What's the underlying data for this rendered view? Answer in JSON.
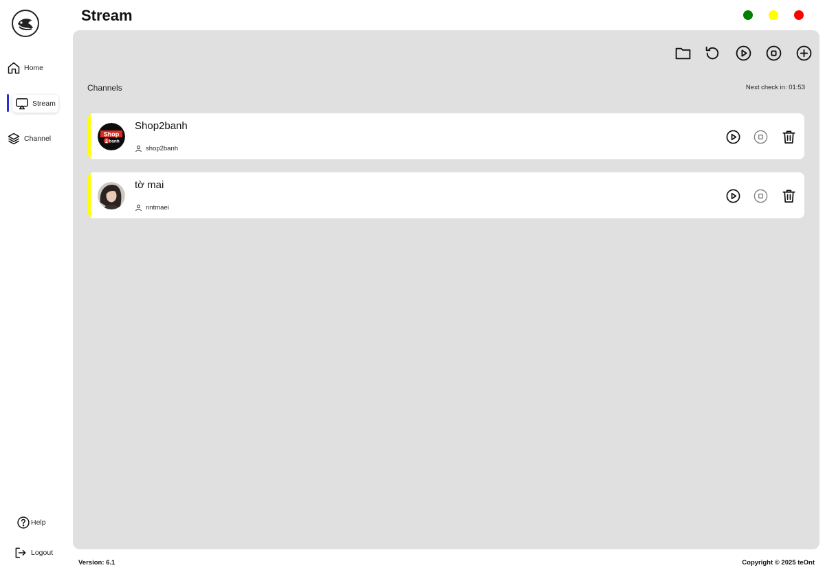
{
  "app": {
    "page_title": "Stream"
  },
  "window_controls": {
    "green": "#008000",
    "yellow": "#ffff00",
    "red": "#ff0000"
  },
  "sidebar": {
    "logo_icon": "fish-logo-icon",
    "items": [
      {
        "label": "Home",
        "icon": "home-icon"
      },
      {
        "label": "Stream",
        "icon": "cast-icon",
        "active": true
      },
      {
        "label": "Channel",
        "icon": "layers-icon"
      }
    ],
    "help": {
      "label": "Help",
      "icon": "question-circle-icon"
    },
    "logout": {
      "label": "Logout",
      "icon": "logout-icon"
    },
    "active_indicator_color": "#2b2bd6"
  },
  "toolbar": {
    "icons": [
      "folder-icon",
      "refresh-icon",
      "play-circle-icon",
      "stop-circle-icon",
      "plus-circle-icon"
    ]
  },
  "main": {
    "section_label": "Channels",
    "next_check": "Next check in: 01:53",
    "panel_color": "#e0e0e0",
    "card_accent_color": "#ffff00",
    "channels": [
      {
        "name": "Shop2banh",
        "username": "shop2banh",
        "avatar_text_1": "Shop",
        "avatar_text_2": "2",
        "avatar_text_3": "banh"
      },
      {
        "name": "tờ mai",
        "username": "nntmaei"
      }
    ]
  },
  "footer": {
    "version": "Version: 6.1",
    "copyright": "Copyright © 2025 teOnt"
  }
}
